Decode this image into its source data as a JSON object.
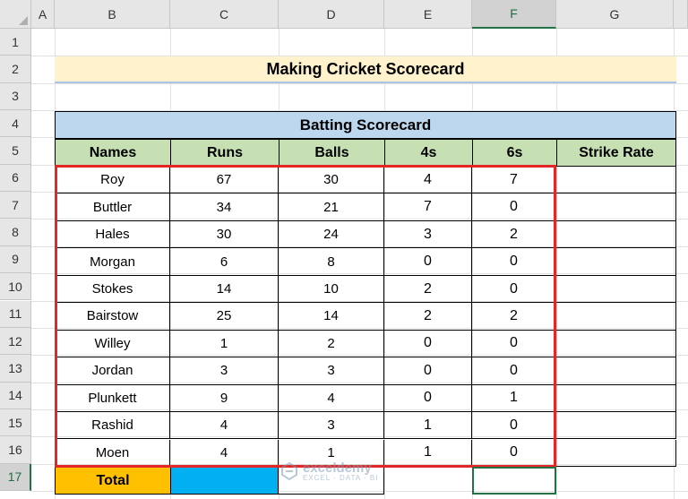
{
  "sheet": {
    "columns": [
      "A",
      "B",
      "C",
      "D",
      "E",
      "F",
      "G"
    ],
    "rows": [
      "1",
      "2",
      "3",
      "4",
      "5",
      "6",
      "7",
      "8",
      "9",
      "10",
      "11",
      "12",
      "13",
      "14",
      "15",
      "16",
      "17"
    ],
    "selected_column": "F",
    "selected_row": "17"
  },
  "title": "Making Cricket Scorecard",
  "table_title": "Batting Scorecard",
  "headers": [
    "Names",
    "Runs",
    "Balls",
    "4s",
    "6s",
    "Strike Rate"
  ],
  "players": [
    {
      "name": "Roy",
      "runs": "67",
      "balls": "30",
      "fours": "4",
      "sixes": "7"
    },
    {
      "name": "Buttler",
      "runs": "34",
      "balls": "21",
      "fours": "7",
      "sixes": "0"
    },
    {
      "name": "Hales",
      "runs": "30",
      "balls": "24",
      "fours": "3",
      "sixes": "2"
    },
    {
      "name": "Morgan",
      "runs": "6",
      "balls": "8",
      "fours": "0",
      "sixes": "0"
    },
    {
      "name": "Stokes",
      "runs": "14",
      "balls": "10",
      "fours": "2",
      "sixes": "0"
    },
    {
      "name": "Bairstow",
      "runs": "25",
      "balls": "14",
      "fours": "2",
      "sixes": "2"
    },
    {
      "name": "Willey",
      "runs": "1",
      "balls": "2",
      "fours": "0",
      "sixes": "0"
    },
    {
      "name": "Jordan",
      "runs": "3",
      "balls": "3",
      "fours": "0",
      "sixes": "0"
    },
    {
      "name": "Plunkett",
      "runs": "9",
      "balls": "4",
      "fours": "0",
      "sixes": "1"
    },
    {
      "name": "Rashid",
      "runs": "4",
      "balls": "3",
      "fours": "1",
      "sixes": "0"
    },
    {
      "name": "Moen",
      "runs": "4",
      "balls": "1",
      "fours": "1",
      "sixes": "0"
    }
  ],
  "total_label": "Total",
  "watermark": {
    "brand": "exceldemy",
    "tagline": "EXCEL · DATA · BI"
  },
  "colors": {
    "header_green": "#c6e0b4",
    "title_yellow": "#fff2cc",
    "table_blue": "#bdd7ee",
    "highlight_red": "#e32626",
    "total_orange": "#ffc000",
    "cell_blue": "#00b0f0",
    "select_green": "#217346"
  }
}
